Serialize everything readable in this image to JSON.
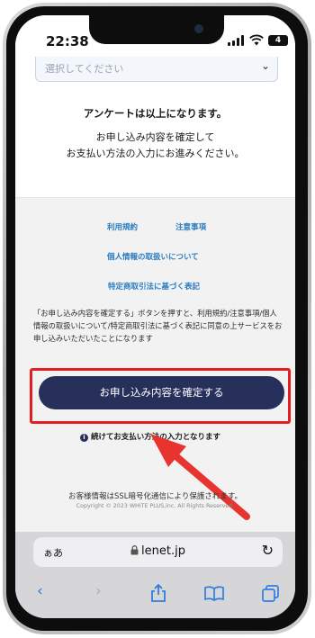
{
  "status": {
    "time": "22:38",
    "battery": "4"
  },
  "form": {
    "select_placeholder": "選択してください"
  },
  "survey": {
    "end_title": "アンケートは以上になります。",
    "line1": "お申し込み内容を確定して",
    "line2": "お支払い方法の入力にお進みください。"
  },
  "links": {
    "terms": "利用規約",
    "notes": "注意事項",
    "privacy": "個人情報の取扱いについて",
    "commerce": "特定商取引法に基づく表記"
  },
  "consent": {
    "text": "「お申し込み内容を確定する」ボタンを押すと、利用規約/注意事項/個人情報の取扱いについて/特定商取引法に基づく表記に同意の上サービスをお申し込みいただいたことになります"
  },
  "cta": {
    "button_label": "お申し込み内容を確定する",
    "note": "続けてお支払い方法の入力となります"
  },
  "footer": {
    "ssl": "お客様情報はSSL暗号化通信により保護されます。",
    "copyright": "Copyright © 2023 WHITE PLUS,inc. All Rights Reserved."
  },
  "browser": {
    "aa": "ぁあ",
    "host": "lenet.jp"
  },
  "colors": {
    "button": "#27305a",
    "link": "#2a7bbf",
    "highlight": "#e61e1e"
  }
}
